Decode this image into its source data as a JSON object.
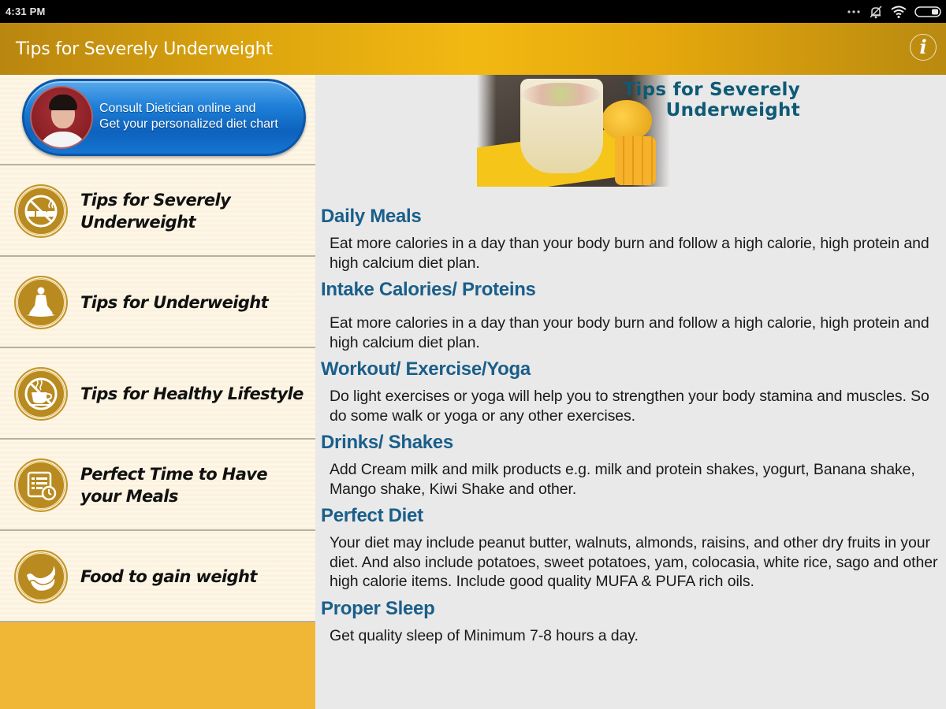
{
  "status_bar": {
    "time": "4:31 PM",
    "icons": [
      "more-dots-icon",
      "bell-muted-icon",
      "wifi-icon",
      "battery-icon"
    ]
  },
  "app_bar": {
    "title": "Tips for Severely Underweight",
    "info_icon": "info-icon",
    "info_glyph": "i",
    "colors": {
      "gradient_start": "#b9860f",
      "gradient_mid": "#f2b812"
    }
  },
  "sidebar": {
    "consult_banner": {
      "line1": "Consult Dietician online and",
      "line2": "Get your personalized diet chart"
    },
    "items": [
      {
        "label": "Tips for Severely Underweight",
        "icon": "no-smoking-icon"
      },
      {
        "label": "Tips for Underweight",
        "icon": "yoga-meditation-icon"
      },
      {
        "label": "Tips for Healthy Lifestyle",
        "icon": "no-coffee-icon"
      },
      {
        "label": "Perfect Time to Have your Meals",
        "icon": "meal-schedule-clock-icon"
      },
      {
        "label": "Food to gain weight",
        "icon": "bananas-icon"
      }
    ],
    "colors": {
      "list_bg": "#fdf3de",
      "footer_bg": "#f0b737",
      "icon_bg": "#b88a1f"
    }
  },
  "content": {
    "hero_title_line1": "Tips for Severely",
    "hero_title_line2": "Underweight",
    "sections": [
      {
        "heading": "Daily Meals",
        "body": "Eat more calories in a day than your body burn and follow a high calorie, high protein and high calcium diet plan."
      },
      {
        "heading": "Intake Calories/ Proteins",
        "body": "Eat more calories in a day than your body burn and follow a high calorie, high protein and high calcium diet plan."
      },
      {
        "heading": "Workout/ Exercise/Yoga",
        "body": "Do light exercises or yoga will help you to strengthen your body stamina and muscles. So do some walk or yoga or any other exercises."
      },
      {
        "heading": "Drinks/ Shakes",
        "body": "Add Cream milk and milk products e.g. milk and protein shakes, yogurt, Banana shake, Mango shake, Kiwi Shake and other."
      },
      {
        "heading": "Perfect Diet",
        "body": "Your diet may include peanut butter, walnuts, almonds, raisins, and other dry fruits in your diet. And also include potatoes, sweet potatoes, yam, colocasia, white rice, sago and other high calorie items. Include good quality MUFA & PUFA rich oils."
      },
      {
        "heading": "Proper Sleep",
        "body": "Get quality sleep of Minimum 7-8 hours a day."
      }
    ],
    "colors": {
      "heading": "#1a5e8a",
      "body": "#1a1a1a",
      "hero_title": "#0f5a75"
    }
  }
}
